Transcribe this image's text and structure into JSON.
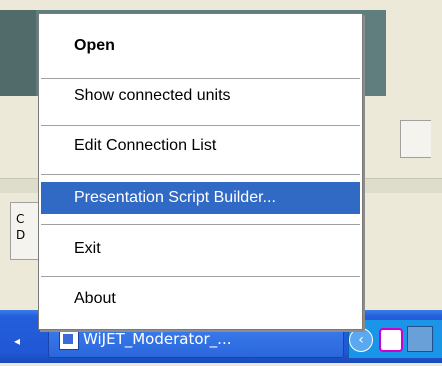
{
  "menu": {
    "items": [
      {
        "label": "Open",
        "bold": true,
        "selected": false
      },
      {
        "label": "Show connected  units",
        "bold": false,
        "selected": false
      },
      {
        "label": "Edit Connection List",
        "bold": false,
        "selected": false
      },
      {
        "label": "Presentation Script Builder...",
        "bold": false,
        "selected": true
      },
      {
        "label": "Exit",
        "bold": false,
        "selected": false
      },
      {
        "label": "About",
        "bold": false,
        "selected": false
      }
    ],
    "selected_color": "#316ac5"
  },
  "taskbar": {
    "task_label": "WiJET_Moderator_...",
    "color": "#245edb"
  },
  "background": {
    "side_text": "C\nD"
  }
}
